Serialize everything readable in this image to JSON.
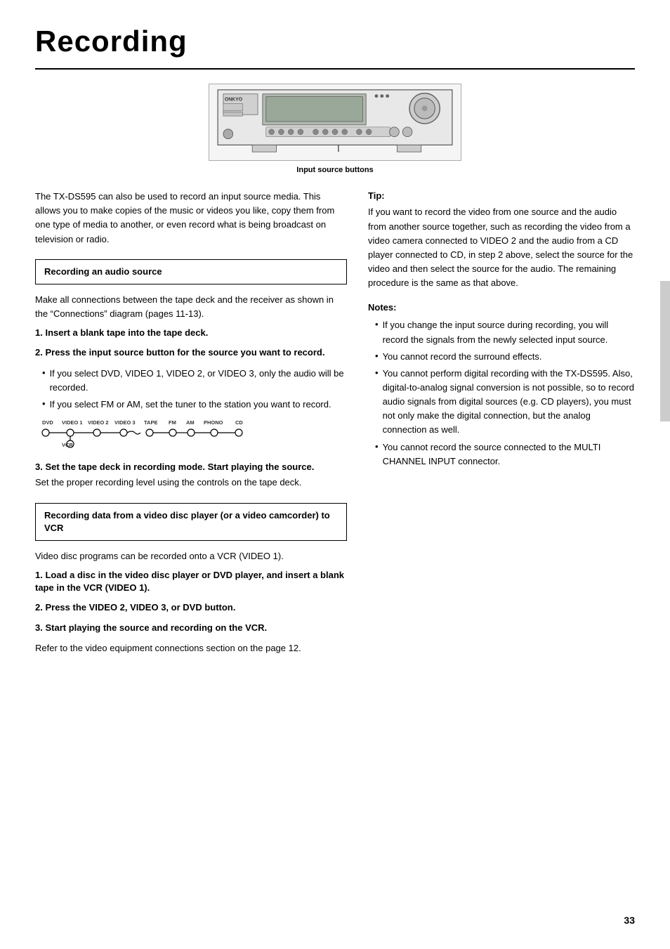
{
  "page": {
    "title": "Recording",
    "page_number": "33"
  },
  "device_image": {
    "caption": "Input source buttons"
  },
  "intro": {
    "text": "The TX-DS595 can also be used to record an input source media. This allows you to make copies of the music or videos you like, copy them from one type of media to another, or even record what is being broadcast on television or radio."
  },
  "section1": {
    "box_title": "Recording an audio source",
    "intro_text": "Make all connections between the tape deck and the receiver as shown in the “Connections” diagram (pages 11-13).",
    "steps": [
      {
        "number": "1.",
        "text": "Insert a blank tape into the tape deck."
      },
      {
        "number": "2.",
        "text": "Press the input source button for the source you want to record."
      }
    ],
    "bullets_step2": [
      "If you select DVD, VIDEO 1, VIDEO 2, or VIDEO 3, only the audio will be recorded.",
      "If you select FM or AM, set the tuner to the station you want to record."
    ],
    "step3": {
      "number": "3.",
      "text": "Set the tape deck in recording mode. Start playing the source.",
      "detail": "Set the proper recording level using the controls on the tape deck."
    }
  },
  "section2": {
    "box_title": "Recording data from a video disc player (or a video camcorder) to VCR",
    "intro_text": "Video disc programs can be recorded onto a VCR (VIDEO 1).",
    "steps": [
      {
        "number": "1.",
        "text": "Load a disc in the video disc player or DVD player, and insert a blank tape in the VCR (VIDEO 1)."
      },
      {
        "number": "2.",
        "text": "Press the VIDEO 2, VIDEO 3, or DVD button."
      },
      {
        "number": "3.",
        "text": "Start playing the source and recording on the VCR."
      }
    ],
    "footer_text": "Refer to the video equipment connections section on the page 12."
  },
  "right_col": {
    "tip_title": "Tip:",
    "tip_text": "If you want to record the video from one source and the audio from another source together, such as recording the video from a video camera connected to VIDEO 2 and the audio from a CD player connected to CD, in step 2 above, select the source for the video and then select the source for the audio. The remaining procedure is the same as that above.",
    "notes_title": "Notes:",
    "notes": [
      "If you change the input source during recording, you will record the signals from the newly selected input source.",
      "You cannot record the surround effects.",
      "You cannot perform digital recording with the TX-DS595. Also, digital-to-analog signal conversion is not possible, so to record audio signals from digital sources (e.g. CD players), you must not only make the digital connection, but the analog connection as well.",
      "You cannot record the source connected to the MULTI CHANNEL INPUT connector."
    ]
  },
  "chain_labels": {
    "dvd": "DVD",
    "video1": "VIDEO 1",
    "video2": "VIDEO 2",
    "video3": "VIDEO 3",
    "vcr": "VCR",
    "tape": "TAPE",
    "fm": "FM",
    "am": "AM",
    "phono": "PHONO",
    "cd": "CD"
  }
}
